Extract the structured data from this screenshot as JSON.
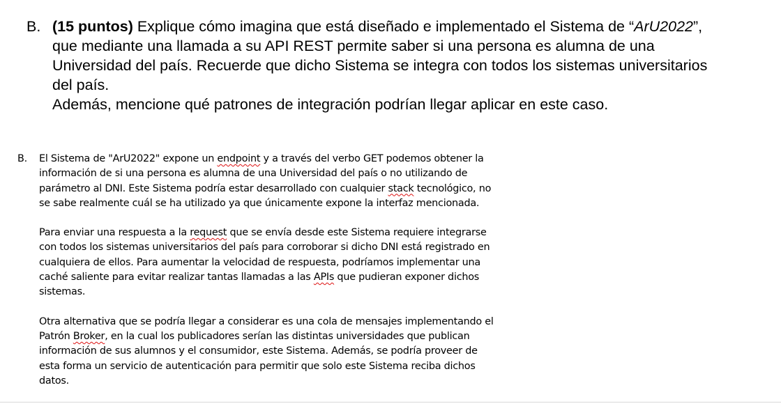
{
  "question": {
    "marker": "B.",
    "points": "(15 puntos)",
    "line1_pre": " Explique cómo imagina que está diseñado e implementado el Sistema de “",
    "line1_italic": "ArU2022",
    "line1_post": "”,",
    "line2": "que mediante una llamada a su API REST permite saber si una persona es alumna de una",
    "line3": "Universidad del país. Recuerde que dicho Sistema se integra con todos los sistemas universitarios",
    "line4": "del país.",
    "line5": "Además, mencione qué patrones de integración podrían llegar aplicar en este caso."
  },
  "answer": {
    "marker": "B.",
    "p1": {
      "l1_a": "El Sistema de \"ArU2022\" expone un ",
      "l1_sq": "endpoint",
      "l1_b": " y a través del verbo GET podemos obtener la",
      "l2": "información de si una persona es alumna de una Universidad del país o no utilizando de",
      "l3_a": "parámetro al DNI. Este Sistema podría estar desarrollado con cualquier ",
      "l3_sq": "stack",
      "l3_b": " tecnológico, no",
      "l4": "se sabe realmente cuál se ha utilizado ya que únicamente expone la interfaz mencionada."
    },
    "p2": {
      "l1_a": "Para enviar una respuesta a la ",
      "l1_sq": "request",
      "l1_b": " que se envía desde este Sistema requiere integrarse",
      "l2": "con todos los sistemas universitarios del país para corroborar si dicho DNI está registrado en",
      "l3": "cualquiera de ellos. Para aumentar la velocidad de respuesta, podríamos implementar una",
      "l4_a": "caché saliente para evitar realizar tantas llamadas a las ",
      "l4_sq": "APIs",
      "l4_b": " que pudieran exponer dichos",
      "l5": "sistemas."
    },
    "p3": {
      "l1": "Otra alternativa que se podría llegar a considerar es una cola de mensajes implementando el",
      "l2_a": "Patrón ",
      "l2_sq": "Broker",
      "l2_b": ", en la cual los publicadores serían las distintas universidades que publican",
      "l3": "información de sus alumnos y el consumidor, este Sistema. Además, se podría proveer de",
      "l4": "esta forma un servicio de autenticación para permitir que solo este Sistema reciba dichos",
      "l5": "datos."
    }
  }
}
